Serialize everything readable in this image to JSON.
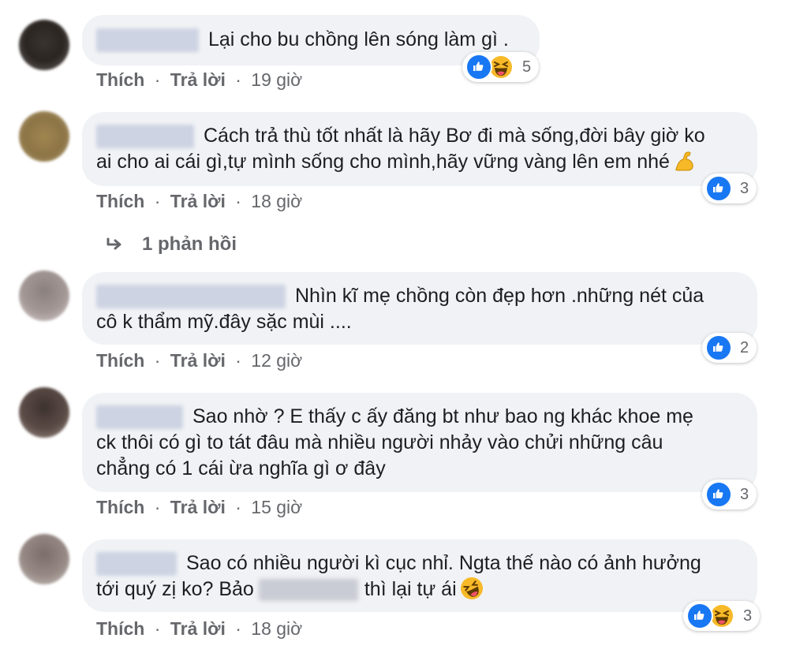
{
  "comments": [
    {
      "text": "Lại cho bu chồng lên sóng làm gì .",
      "actions": {
        "like": "Thích",
        "reply": "Trả lời",
        "sep": "·",
        "time": "19 giờ"
      },
      "reactions": {
        "types": [
          "like",
          "haha"
        ],
        "count": "5"
      }
    },
    {
      "text_line1": "Cách trả thù tốt nhất là hãy Bơ đi mà sống,đời bây giờ ko",
      "text_line2": "ai cho ai cái gì,tự mình sống cho mình,hãy vững vàng lên em nhé",
      "emoji": "flexed-biceps",
      "actions": {
        "like": "Thích",
        "reply": "Trả lời",
        "sep": "·",
        "time": "18 giờ"
      },
      "reactions": {
        "types": [
          "like"
        ],
        "count": "3"
      },
      "replies_label": "1 phản hồi"
    },
    {
      "text_line1": "Nhìn kĩ mẹ chồng còn đẹp hơn .những nét của",
      "text_line2": "cô k thẩm mỹ.đây sặc mùi ....",
      "actions": {
        "like": "Thích",
        "reply": "Trả lời",
        "sep": "·",
        "time": "12 giờ"
      },
      "reactions": {
        "types": [
          "like"
        ],
        "count": "2"
      }
    },
    {
      "text_line1": "Sao nhờ ? E thấy c ấy đăng bt như bao ng khác khoe mẹ",
      "text_line2": "ck thôi có gì to tát đâu mà nhiều người nhảy vào chửi những câu",
      "text_line3": "chẳng có 1 cái ừa nghĩa gì ơ đây",
      "actions": {
        "like": "Thích",
        "reply": "Trả lời",
        "sep": "·",
        "time": "15 giờ"
      },
      "reactions": {
        "types": [
          "like"
        ],
        "count": "3"
      }
    },
    {
      "text_line1": "Sao có nhiều người kì cục nhỉ. Ngta thế nào có ảnh hưởng",
      "text_line2a": "tới quý zị ko? Bảo",
      "text_line2b": "thì lại tự ái",
      "emoji": "rolling-on-floor-laughing",
      "actions": {
        "like": "Thích",
        "reply": "Trả lời",
        "sep": "·",
        "time": "18 giờ"
      },
      "reactions": {
        "types": [
          "like",
          "haha"
        ],
        "count": "3"
      }
    }
  ],
  "colors": {
    "like_blue": "#1877f2",
    "haha_yellow": "#f7b928",
    "bubble_bg": "#f0f2f5",
    "meta_gray": "#65676b"
  }
}
